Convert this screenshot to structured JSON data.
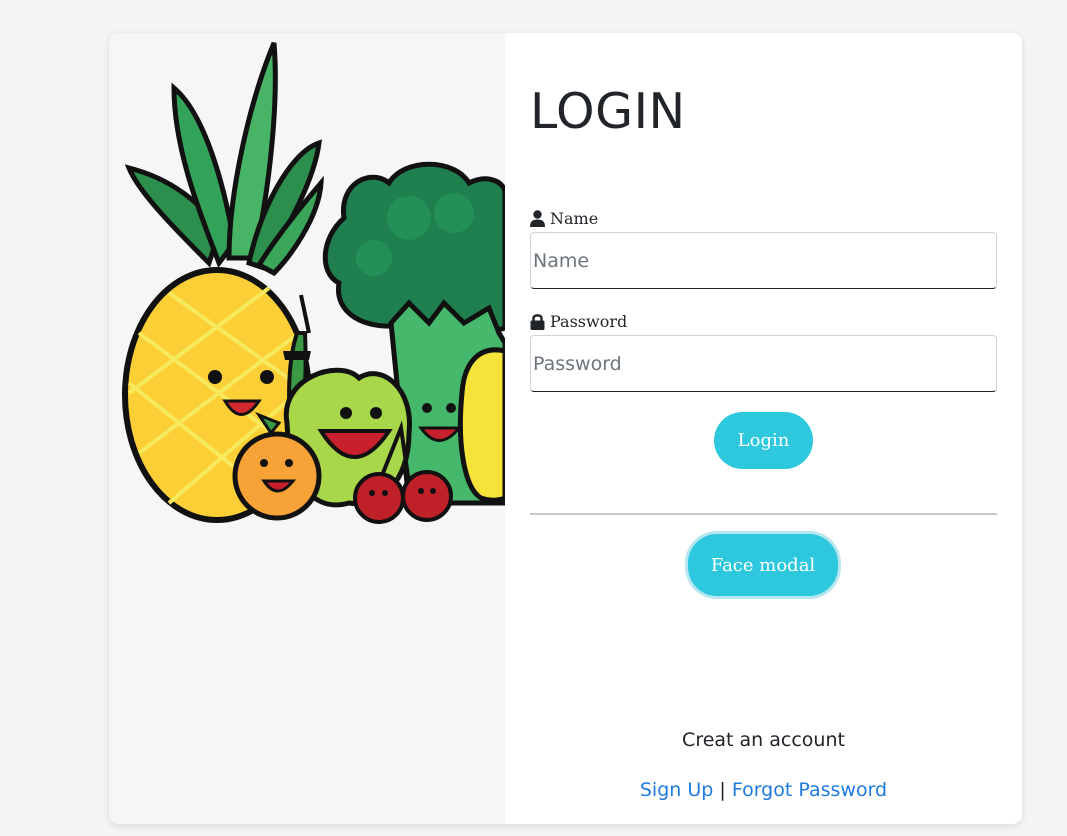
{
  "login_form": {
    "title": "LOGIN",
    "name_label": "Name",
    "name_placeholder": "Name",
    "password_label": "Password",
    "password_placeholder": "Password",
    "login_button": "Login",
    "face_button": "Face modal"
  },
  "footer": {
    "create_text": "Creat an account",
    "signup_link": "Sign Up",
    "separator": "|",
    "forgot_link": "Forgot Password"
  },
  "colors": {
    "page_bg": "#f5f5f5",
    "button": "#2ec8de",
    "link": "#1f7ae0",
    "text": "#212529"
  },
  "icons": [
    "user-icon",
    "lock-icon"
  ]
}
